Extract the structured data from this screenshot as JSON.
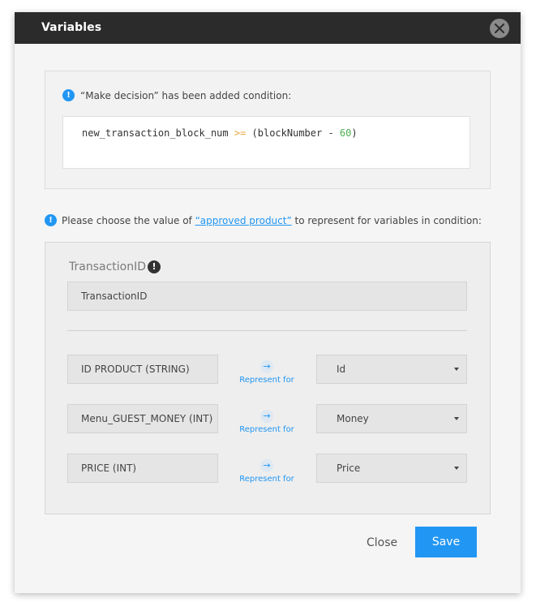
{
  "dialog": {
    "title": "Variables"
  },
  "notice": {
    "text": "“Make decision” has been added condition:",
    "code": {
      "left": "new_transaction_block_num ",
      "operator": ">=",
      "middle": " (blockNumber - ",
      "number": "60",
      "end": ")"
    }
  },
  "instruction": {
    "prefix": "Please choose the value of ",
    "link": "“approved product”",
    "suffix": " to represent for variables in condition:"
  },
  "field": {
    "label": "TransactionID",
    "value": "TransactionID"
  },
  "mappings": [
    {
      "variable": "ID PRODUCT (STRING)",
      "represent_label": "Represent for",
      "selected": "Id"
    },
    {
      "variable": "Menu_GUEST_MONEY (INT)",
      "represent_label": "Represent for",
      "selected": "Money"
    },
    {
      "variable": "PRICE (INT)",
      "represent_label": "Represent for",
      "selected": "Price"
    }
  ],
  "buttons": {
    "close": "Close",
    "save": "Save"
  },
  "colors": {
    "accent": "#2196f3",
    "header": "#2b2b2b",
    "operator": "#e8a93b",
    "number": "#4caf50"
  }
}
